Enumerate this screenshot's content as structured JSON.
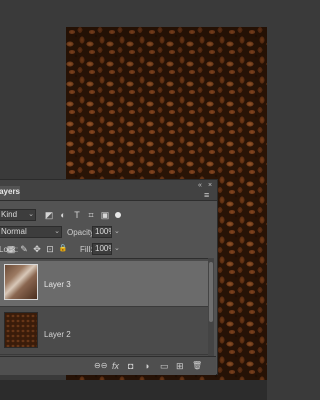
{
  "panel": {
    "tab_label": "Layers",
    "filter": {
      "kind": "Kind"
    },
    "blend_mode": "Normal",
    "opacity_label": "Opacity:",
    "opacity_value": "100%",
    "lock_label": "Lock:",
    "fill_label": "Fill:",
    "fill_value": "100%",
    "icons": {
      "collapse": "«",
      "close": "×",
      "menu": "≡",
      "caret": "⌄",
      "image_filter": "◩",
      "adjustment_filter": "◐",
      "type_filter": "T",
      "shape_filter": "⌗",
      "smart_filter": "▣",
      "lock_transparent": "▦",
      "lock_pixels": "✎",
      "lock_position": "✥",
      "lock_artboard": "⊡",
      "lock_all": "🔒",
      "link": "⊖⊖",
      "fx": "fx",
      "mask": "◘",
      "adjustment": "◑",
      "group": "▭",
      "new_layer": "⊞",
      "delete": "🗑"
    }
  },
  "layers": [
    {
      "name": "Layer 3",
      "selected": true
    },
    {
      "name": "Layer 2",
      "selected": false
    }
  ]
}
